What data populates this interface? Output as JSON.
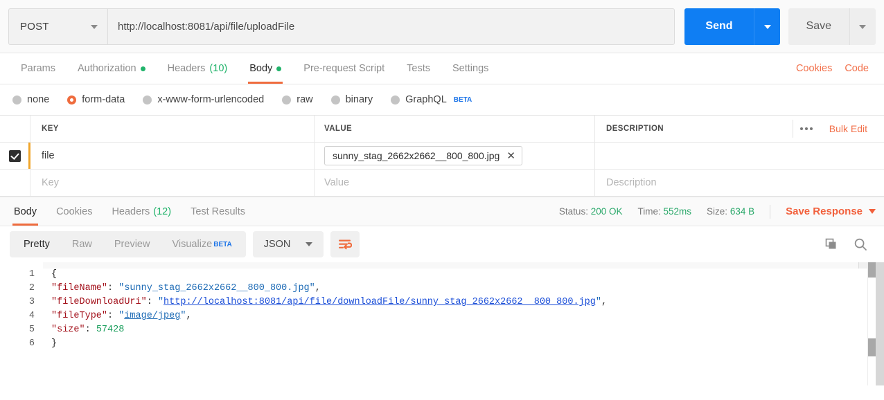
{
  "request": {
    "method": "POST",
    "url": "http://localhost:8081/api/file/uploadFile",
    "send_label": "Send",
    "save_label": "Save",
    "tabs": [
      {
        "label": "Params",
        "badge": "",
        "dot": false,
        "active": false
      },
      {
        "label": "Authorization",
        "badge": "",
        "dot": true,
        "active": false
      },
      {
        "label": "Headers",
        "badge": "(10)",
        "dot": false,
        "active": false
      },
      {
        "label": "Body",
        "badge": "",
        "dot": true,
        "active": true
      },
      {
        "label": "Pre-request Script",
        "badge": "",
        "dot": false,
        "active": false
      },
      {
        "label": "Tests",
        "badge": "",
        "dot": false,
        "active": false
      },
      {
        "label": "Settings",
        "badge": "",
        "dot": false,
        "active": false
      }
    ],
    "links": {
      "cookies": "Cookies",
      "code": "Code"
    },
    "body_types": [
      {
        "label": "none",
        "selected": false,
        "beta": ""
      },
      {
        "label": "form-data",
        "selected": true,
        "beta": ""
      },
      {
        "label": "x-www-form-urlencoded",
        "selected": false,
        "beta": ""
      },
      {
        "label": "raw",
        "selected": false,
        "beta": ""
      },
      {
        "label": "binary",
        "selected": false,
        "beta": ""
      },
      {
        "label": "GraphQL",
        "selected": false,
        "beta": "BETA"
      }
    ]
  },
  "table": {
    "columns": {
      "key": "KEY",
      "value": "VALUE",
      "description": "DESCRIPTION"
    },
    "bulk_edit": "Bulk Edit",
    "rows": [
      {
        "checked": true,
        "key": "file",
        "value_chip": "sunny_stag_2662x2662__800_800.jpg",
        "chip_remove": "✕",
        "description": ""
      }
    ],
    "placeholder_row": {
      "key": "Key",
      "value": "Value",
      "description": "Description"
    }
  },
  "response": {
    "tabs": [
      {
        "label": "Body",
        "badge": "",
        "active": true
      },
      {
        "label": "Cookies",
        "badge": "",
        "active": false
      },
      {
        "label": "Headers",
        "badge": "(12)",
        "active": false
      },
      {
        "label": "Test Results",
        "badge": "",
        "active": false
      }
    ],
    "status_label": "Status:",
    "status_value": "200 OK",
    "time_label": "Time:",
    "time_value": "552ms",
    "size_label": "Size:",
    "size_value": "634 B",
    "save_response": "Save Response",
    "view_modes": [
      {
        "label": "Pretty",
        "active": true,
        "beta": ""
      },
      {
        "label": "Raw",
        "active": false,
        "beta": ""
      },
      {
        "label": "Preview",
        "active": false,
        "beta": ""
      },
      {
        "label": "Visualize",
        "active": false,
        "beta": "BETA"
      }
    ],
    "format": "JSON",
    "icons": {
      "wrap": "word-wrap-icon",
      "copy": "copy-icon",
      "search": "search-icon"
    },
    "line_numbers": [
      "1",
      "2",
      "3",
      "4",
      "5",
      "6"
    ],
    "json": {
      "fileName_key": "\"fileName\"",
      "fileName_value": "\"sunny_stag_2662x2662__800_800.jpg\"",
      "fileDownloadUri_key": "\"fileDownloadUri\"",
      "fileDownloadUri_value": "http://localhost:8081/api/file/downloadFile/sunny_stag_2662x2662__800_800.jpg",
      "fileType_key": "\"fileType\"",
      "fileType_value": "image/jpeg",
      "size_key": "\"size\"",
      "size_value": "57428",
      "open_brace": "{",
      "close_brace": "}"
    }
  },
  "colors": {
    "accent_orange": "#ef6c3e",
    "send_blue": "#0f7ef3",
    "green": "#20b36a",
    "link_orange": "#f2704a",
    "beta_blue": "#1a73e8",
    "row_marker": "#f0a52b"
  }
}
